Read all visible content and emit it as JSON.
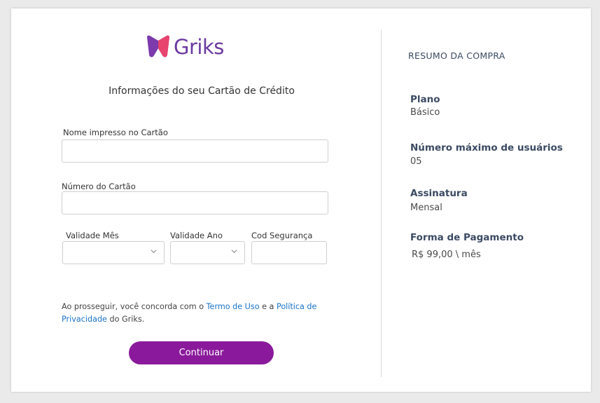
{
  "brand": {
    "name": "Griks",
    "color": "#6b3aa0",
    "mark_colors": [
      "#7c3aad",
      "#e8436e"
    ]
  },
  "form": {
    "title": "Informações do seu Cartão de Crédito",
    "name_label": "Nome impresso no Cartão",
    "name_value": "",
    "number_label": "Número do Cartão",
    "number_value": "",
    "month_label": "Validade Mês",
    "month_value": "",
    "year_label": "Validade Ano",
    "year_value": "",
    "cvv_label": "Cod Segurança",
    "cvv_value": ""
  },
  "terms": {
    "prefix": "Ao prosseguir, você concorda com o",
    "terms_link": "Termo de Uso",
    "middle": "e a",
    "privacy_link": "Política de Privacidade",
    "suffix": "do Griks."
  },
  "button": {
    "continue_label": "Continuar",
    "color": "#8a1a9b"
  },
  "summary": {
    "title": "RESUMO DA COMPRA",
    "plan_heading": "Plano",
    "plan_value": "Básico",
    "users_heading": "Número máximo de usuários",
    "users_value": "05",
    "subscription_heading": "Assinatura",
    "subscription_value": "Mensal",
    "payment_heading": "Forma de Pagamento",
    "payment_value": "R$ 99,00 \\ mês"
  },
  "icons": {
    "select_arrow": "chevron-down-icon",
    "logo": "griks-tooth-logo-icon"
  }
}
